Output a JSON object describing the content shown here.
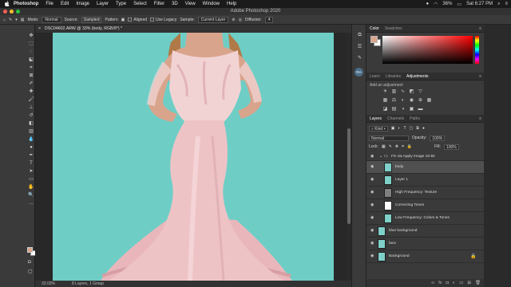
{
  "menubar": {
    "apple": "",
    "items": [
      "Photoshop",
      "File",
      "Edit",
      "Image",
      "Layer",
      "Type",
      "Select",
      "Filter",
      "3D",
      "View",
      "Window",
      "Help"
    ],
    "battery": "36%",
    "clock": "Sat 6:27 PM"
  },
  "window": {
    "title": "Adobe Photoshop 2020"
  },
  "options": {
    "mode_label": "Mode:",
    "mode_value": "Normal",
    "source_label": "Source:",
    "source_sampled": "Sampled",
    "source_pattern": "Pattern",
    "aligned": "Aligned",
    "use_legacy": "Use Legacy",
    "sample_label": "Sample:",
    "sample_value": "Current Layer",
    "diffusion_label": "Diffusion:",
    "diffusion_value": "4"
  },
  "document": {
    "tab_title": "DSC04602.ARW @ 33% (body, RGB/8*) *",
    "zoom": "33.03%",
    "layer_info": "8 Layers, 1 Group"
  },
  "color_panel": {
    "tabs": [
      "Color",
      "Swatches"
    ],
    "fg": "#d9a48c",
    "bg": "#ffffff"
  },
  "adjust_panel": {
    "tabs": [
      "Learn",
      "Libraries",
      "Adjustments"
    ],
    "add_label": "Add an adjustment"
  },
  "layers_panel": {
    "tabs": [
      "Layers",
      "Channels",
      "Paths"
    ],
    "kind_value": "Kind",
    "blend_value": "Normal",
    "opacity_label": "Opacity:",
    "opacity_value": "100%",
    "lock_label": "Lock:",
    "fill_label": "Fill:",
    "fill_value": "100%",
    "group_name": "FS via Apply Image 16-bit",
    "layers": [
      {
        "name": "body",
        "active": true
      },
      {
        "name": "Layer 1",
        "active": false
      },
      {
        "name": "High Frequency: Texture",
        "active": false
      },
      {
        "name": "Correcting Tones",
        "active": false
      },
      {
        "name": "Low Frequency: Colors & Tones",
        "active": false
      },
      {
        "name": "blue background",
        "active": false
      },
      {
        "name": "face",
        "active": false
      },
      {
        "name": "Background",
        "active": false
      }
    ]
  },
  "dock": {
    "avatar": "RA"
  },
  "colors": {
    "backdrop": "#6ecec6",
    "dress": "#eec3c6",
    "skin": "#d9a48c",
    "hair": "#b07a48"
  }
}
